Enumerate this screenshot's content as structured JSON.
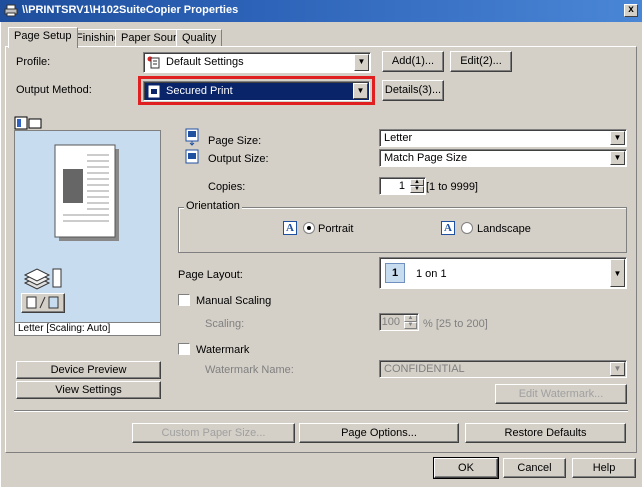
{
  "window": {
    "title": "\\\\PRINTSRV1\\H102SuiteCopier Properties",
    "close_glyph": "x"
  },
  "tabs": [
    "Page Setup",
    "Finishing",
    "Paper Source",
    "Quality"
  ],
  "profile": {
    "label": "Profile:",
    "value": "Default Settings",
    "add_label": "Add(1)...",
    "edit_label": "Edit(2)..."
  },
  "output_method": {
    "label": "Output Method:",
    "value": "Secured Print",
    "details_label": "Details(3)..."
  },
  "page_size": {
    "label": "Page Size:",
    "value": "Letter"
  },
  "output_size": {
    "label": "Output Size:",
    "value": "Match Page Size"
  },
  "copies": {
    "label": "Copies:",
    "value": "1",
    "range": "[1 to 9999]"
  },
  "orientation": {
    "label": "Orientation",
    "portrait_label": "Portrait",
    "landscape_label": "Landscape",
    "glyph": "A",
    "selected": "Portrait"
  },
  "page_layout": {
    "label": "Page Layout:",
    "icon_number": "1",
    "value": "1 on 1"
  },
  "manual_scaling": {
    "label": "Manual Scaling",
    "scaling_label": "Scaling:",
    "value": "100",
    "range": "% [25 to 200]"
  },
  "watermark": {
    "label": "Watermark",
    "name_label": "Watermark Name:",
    "value": "CONFIDENTIAL",
    "edit_label": "Edit Watermark..."
  },
  "preview": {
    "caption": "Letter [Scaling: Auto]"
  },
  "buttons": {
    "device_preview": "Device Preview",
    "view_settings": "View Settings",
    "custom_paper_size": "Custom Paper Size...",
    "page_options": "Page Options...",
    "restore_defaults": "Restore Defaults",
    "ok": "OK",
    "cancel": "Cancel",
    "help": "Help"
  },
  "colors": {
    "highlight": "#e02020",
    "selection": "#0a246a",
    "preview_bg": "#c8dcf0"
  }
}
